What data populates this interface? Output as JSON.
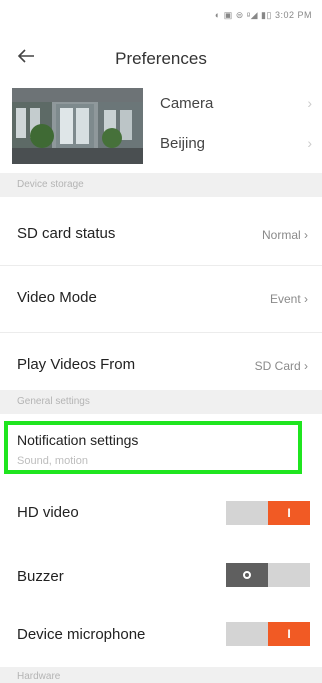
{
  "status_bar": {
    "text": "◐ ▣ ⊜ ᵍ◢ ▮▯ 3:02 PM"
  },
  "header": {
    "title": "Preferences"
  },
  "camera": {
    "name": "Camera",
    "location": "Beijing",
    "chevron": "›"
  },
  "sections": {
    "device_storage": "Device storage",
    "general_settings": "General settings",
    "hardware": "Hardware"
  },
  "rows": {
    "sd_card": {
      "label": "SD card status",
      "value": "Normal ›"
    },
    "video_mode": {
      "label": "Video Mode",
      "value": "Event ›"
    },
    "play_videos": {
      "label": "Play Videos From",
      "value": "SD Card ›"
    }
  },
  "notification": {
    "title": "Notification settings",
    "subtitle": "Sound, motion"
  },
  "toggles": {
    "hd_video": {
      "label": "HD video",
      "state": "on",
      "glyph": "I"
    },
    "buzzer": {
      "label": "Buzzer",
      "state": "off"
    },
    "microphone": {
      "label": "Device microphone",
      "state": "on",
      "glyph": "I"
    }
  },
  "colors": {
    "accent": "#f15a24",
    "toggle_off_knob": "#5f5f5f",
    "highlight": "#1fe51f",
    "section_bg": "#f0f0f0"
  }
}
